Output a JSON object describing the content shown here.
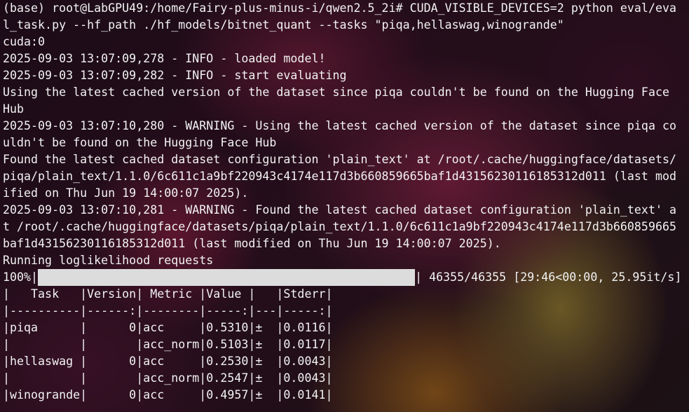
{
  "terminal": {
    "lines": [
      "(base) root@LabGPU49:/home/Fairy-plus-minus-i/qwen2.5_2i# CUDA_VISIBLE_DEVICES=2 python eval/eva",
      "l_task.py --hf_path ./hf_models/bitnet_quant --tasks \"piqa,hellaswag,winogrande\"",
      "cuda:0",
      "2025-09-03 13:07:09,278 - INFO - loaded model!",
      "2025-09-03 13:07:09,282 - INFO - start evaluating",
      "Using the latest cached version of the dataset since piqa couldn't be found on the Hugging Face",
      "Hub",
      "2025-09-03 13:07:10,280 - WARNING - Using the latest cached version of the dataset since piqa co",
      "uldn't be found on the Hugging Face Hub",
      "Found the latest cached dataset configuration 'plain_text' at /root/.cache/huggingface/datasets/",
      "piqa/plain_text/1.1.0/6c611c1a9bf220943c4174e117d3b660859665baf1d43156230116185312d011 (last mod",
      "ified on Thu Jun 19 14:00:07 2025).",
      "2025-09-03 13:07:10,281 - WARNING - Found the latest cached dataset configuration 'plain_text' a",
      "t /root/.cache/huggingface/datasets/piqa/plain_text/1.1.0/6c611c1a9bf220943c4174e117d3b660859665",
      "baf1d43156230116185312d011 (last modified on Thu Jun 19 14:00:07 2025).",
      "Running loglikelihood requests"
    ],
    "progress": {
      "percent_label": "100%|",
      "fraction": 1.0,
      "suffix": "| 46355/46355 [29:46<00:00, 25.95it/s]"
    },
    "table_lines": [
      "|   Task   |Version| Metric |Value |   |Stderr|",
      "|----------|------:|--------|-----:|---|-----:|",
      "|piqa      |      0|acc     |0.5310|±  |0.0116|",
      "|          |       |acc_norm|0.5103|±  |0.0117|",
      "|hellaswag |      0|acc     |0.2530|±  |0.0043|",
      "|          |       |acc_norm|0.2547|±  |0.0043|",
      "|winogrande|      0|acc     |0.4957|±  |0.0141|"
    ]
  }
}
